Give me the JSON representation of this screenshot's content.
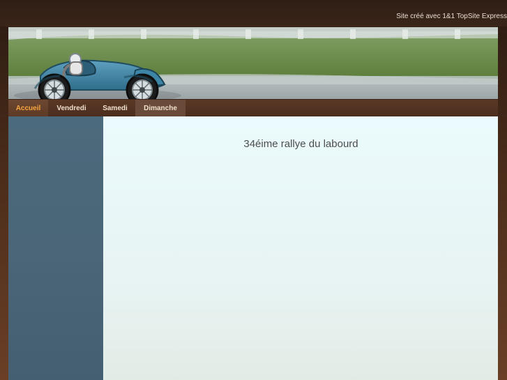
{
  "header": {
    "credit_text": "Site créé avec 1&1 TopSite Express"
  },
  "nav": {
    "items": [
      {
        "label": "Accueil",
        "active": true
      },
      {
        "label": "Vendredi",
        "active": false
      },
      {
        "label": "Samedi",
        "active": false
      },
      {
        "label": "Dimanche",
        "active": false
      }
    ]
  },
  "main": {
    "title": "34éime rallye du labourd"
  },
  "colors": {
    "nav_active_text": "#f7a640",
    "nav_text": "#f2e1cc",
    "sidebar": "#4a6678",
    "content_bg": "#e9f7f8",
    "page_bg": "#4a2c1a"
  },
  "banner": {
    "image_description_icon": "vintage-race-car"
  }
}
